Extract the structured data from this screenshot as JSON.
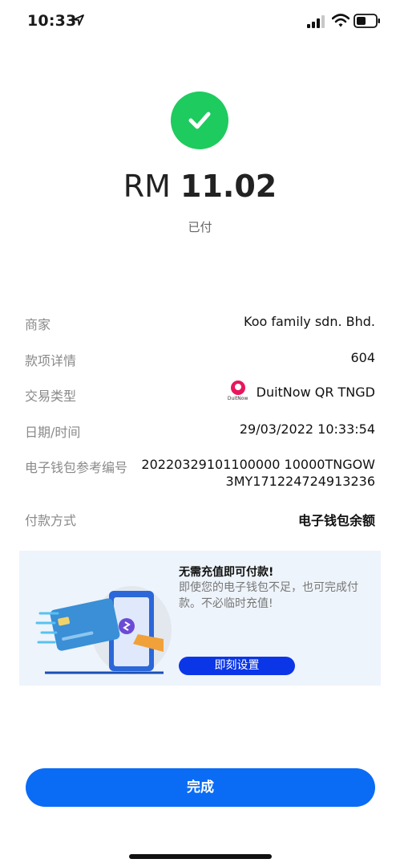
{
  "status_bar": {
    "time": "10:33",
    "icons": [
      "location-arrow-icon",
      "cellular-signal-icon",
      "wifi-icon",
      "battery-icon"
    ]
  },
  "header": {
    "status_icon": "checkmark-icon",
    "currency": "RM",
    "amount": "11.02",
    "status_text": "已付"
  },
  "details": [
    {
      "label": "商家",
      "value": "Koo family sdn. Bhd."
    },
    {
      "label": "款项详情",
      "value": "604"
    },
    {
      "label": "交易类型",
      "value": "DuitNow QR TNGD",
      "logo_text": "DuitNow"
    },
    {
      "label": "日期/时间",
      "value": "29/03/2022 10:33:54"
    },
    {
      "label": "电子钱包参考编号",
      "value_line1": "20220329101100000 10000TNGOW",
      "value_line2": "3MY171224724913236"
    },
    {
      "label": "付款方式",
      "value": "电子钱包余额"
    }
  ],
  "promo": {
    "title": "无需充值即可付款!",
    "description": "即使您的电子钱包不足，也可完成付款。不必临时充值!",
    "button_label": "即刻设置"
  },
  "footer": {
    "done_label": "完成"
  },
  "colors": {
    "success_green": "#1ecb5e",
    "primary_blue": "#0a6cf5",
    "promo_button_blue": "#0b36e8",
    "promo_bg": "#eef4fb",
    "duitnow_pink": "#e8175d"
  }
}
